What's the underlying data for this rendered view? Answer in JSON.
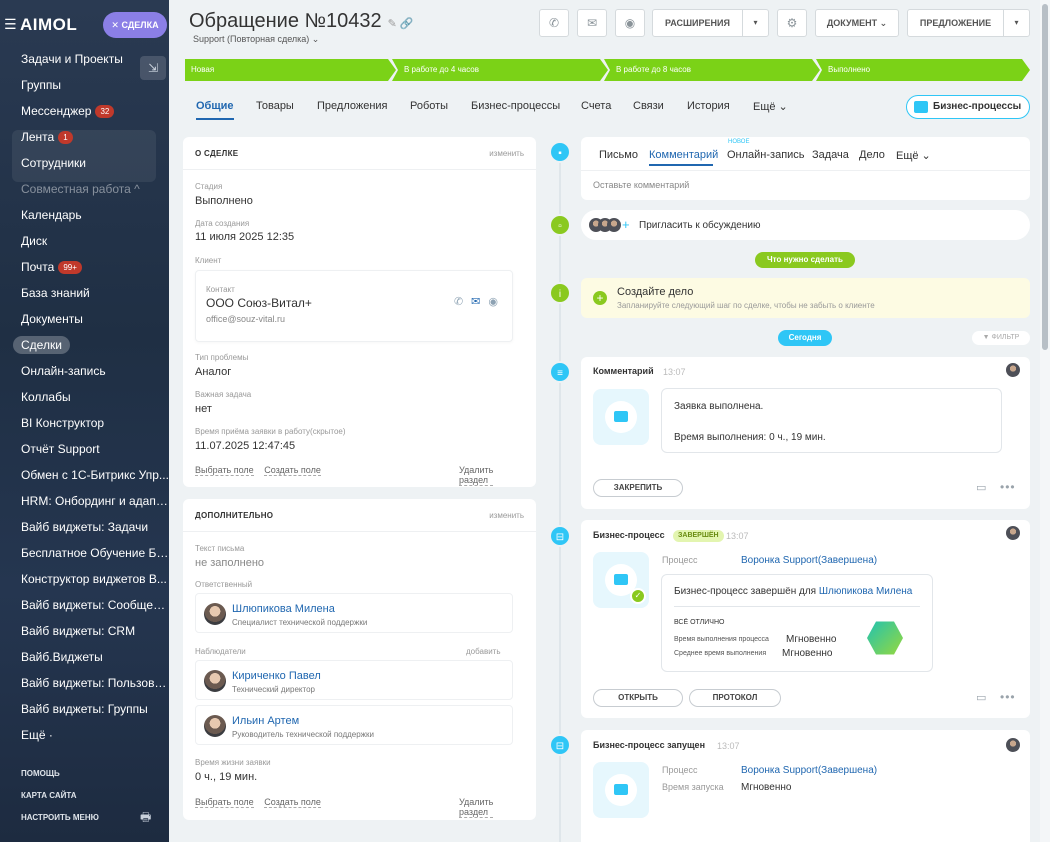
{
  "sidebar": {
    "logo": "AIMOL",
    "deal_button": "✕ СДЕЛКА",
    "items": [
      {
        "label": "Задачи и Проекты"
      },
      {
        "label": "Группы"
      },
      {
        "label": "Мессенджер",
        "badge": "32"
      },
      {
        "label": "Лента",
        "badge": "1"
      },
      {
        "label": "Сотрудники"
      },
      {
        "label": "Совместная работа ^"
      },
      {
        "label": "Календарь"
      },
      {
        "label": "Диск"
      },
      {
        "label": "Почта",
        "badge": "99+"
      },
      {
        "label": "База знаний"
      },
      {
        "label": "Документы"
      },
      {
        "label": "Сделки"
      },
      {
        "label": "Онлайн-запись"
      },
      {
        "label": "Коллабы"
      },
      {
        "label": "BI Конструктор"
      },
      {
        "label": "Отчёт Support"
      },
      {
        "label": "Обмен с 1С-Битрикс Упр..."
      },
      {
        "label": "HRM: Онбординг и адапт..."
      },
      {
        "label": "Вайб виджеты: Задачи"
      },
      {
        "label": "Бесплатное Обучение Би..."
      },
      {
        "label": "Конструктор виджетов В..."
      },
      {
        "label": "Вайб виджеты: Сообщен..."
      },
      {
        "label": "Вайб виджеты: CRM"
      },
      {
        "label": "Вайб.Виджеты"
      },
      {
        "label": "Вайб виджеты: Пользова..."
      },
      {
        "label": "Вайб виджеты: Группы"
      },
      {
        "label": "Ещё ·"
      }
    ],
    "footer": [
      "ПОМОЩЬ",
      "КАРТА САЙТА",
      "НАСТРОИТЬ МЕНЮ"
    ]
  },
  "header": {
    "title": "Обращение №10432",
    "subtitle": "Support (Повторная сделка) ⌄",
    "btn_extensions": "РАСШИРЕНИЯ",
    "btn_document": "ДОКУМЕНТ ⌄",
    "btn_offer": "ПРЕДЛОЖЕНИЕ"
  },
  "stages": [
    "Новая",
    "В работе до 4 часов",
    "В работе до 8 часов",
    "Выполнено"
  ],
  "tabs": [
    "Общие",
    "Товары",
    "Предложения",
    "Роботы",
    "Бизнес-процессы",
    "Счета",
    "Связи",
    "История",
    "Ещё ⌄"
  ],
  "bp_button": "Бизнес-процессы",
  "about": {
    "title": "О СДЕЛКЕ",
    "edit": "изменить",
    "stage_label": "Стадия",
    "stage_value": "Выполнено",
    "created_label": "Дата создания",
    "created_value": "11 июля 2025 12:35",
    "client_label": "Клиент",
    "contact_label": "Контакт",
    "contact_name": "ООО Союз-Витал+",
    "contact_email": "office@souz-vital.ru",
    "problem_label": "Тип проблемы",
    "problem_value": "Аналог",
    "important_label": "Важная задача",
    "important_value": "нет",
    "accept_label": "Время приёма заявки в работу(скрытое)",
    "accept_value": "11.07.2025 12:47:45",
    "select_field": "Выбрать поле",
    "create_field": "Создать поле",
    "delete_section": "Удалить раздел"
  },
  "extra": {
    "title": "ДОПОЛНИТЕЛЬНО",
    "edit": "изменить",
    "letter_label": "Текст письма",
    "letter_value": "не заполнено",
    "responsible_label": "Ответственный",
    "responsible": {
      "name": "Шлюпикова Милена",
      "role": "Специалист технической поддержки"
    },
    "observers_label": "Наблюдатели",
    "observers_add": "добавить",
    "observers": [
      {
        "name": "Кириченко Павел",
        "role": "Технический директор"
      },
      {
        "name": "Ильин Артем",
        "role": "Руководитель технической поддержки"
      }
    ],
    "lifetime_label": "Время жизни заявки",
    "lifetime_value": "0 ч., 19 мин.",
    "select_field": "Выбрать поле",
    "create_field": "Создать поле",
    "delete_section": "Удалить раздел"
  },
  "timeline": {
    "composer_tabs": [
      "Письмо",
      "Комментарий",
      "Онлайн-запись",
      "Задача",
      "Дело",
      "Ещё ⌄"
    ],
    "new_badge": "НОВОЕ",
    "comment_placeholder": "Оставьте комментарий",
    "invite": "Пригласить к обсуждению",
    "todo_pill": "Что нужно сделать",
    "create_task_title": "Создайте дело",
    "create_task_sub": "Запланируйте следующий шаг по сделке, чтобы не забыть о клиенте",
    "today_pill": "Сегодня",
    "filter": "ФИЛЬТР",
    "comment_item": {
      "title": "Комментарий",
      "time": "13:07",
      "line1": "Заявка выполнена.",
      "line2": "Время выполнения: 0 ч., 19 мин.",
      "pin": "ЗАКРЕПИТЬ"
    },
    "bp_done": {
      "title": "Бизнес-процесс",
      "badge": "ЗАВЕРШЁН",
      "time": "13:07",
      "process_label": "Процесс",
      "process_value": "Воронка Support(Завершена)",
      "finished_text": "Бизнес-процесс завершён для",
      "finished_who": "Шлюпикова Милена",
      "rating": "ВСЁ ОТЛИЧНО",
      "exec_label": "Время выполнения процесса",
      "exec_value": "Мгновенно",
      "avg_label": "Среднее время выполнения",
      "avg_value": "Мгновенно",
      "open": "ОТКРЫТЬ",
      "protocol": "ПРОТОКОЛ"
    },
    "bp_started": {
      "title": "Бизнес-процесс запущен",
      "time": "13:07",
      "process_label": "Процесс",
      "process_value": "Воронка Support(Завершена)",
      "launch_label": "Время запуска",
      "launch_value": "Мгновенно"
    }
  },
  "colors": {
    "accent": "#2067b0",
    "stage": "#7bd217",
    "timeline_blue": "#2fc6f6",
    "timeline_green": "#8ac91f"
  }
}
